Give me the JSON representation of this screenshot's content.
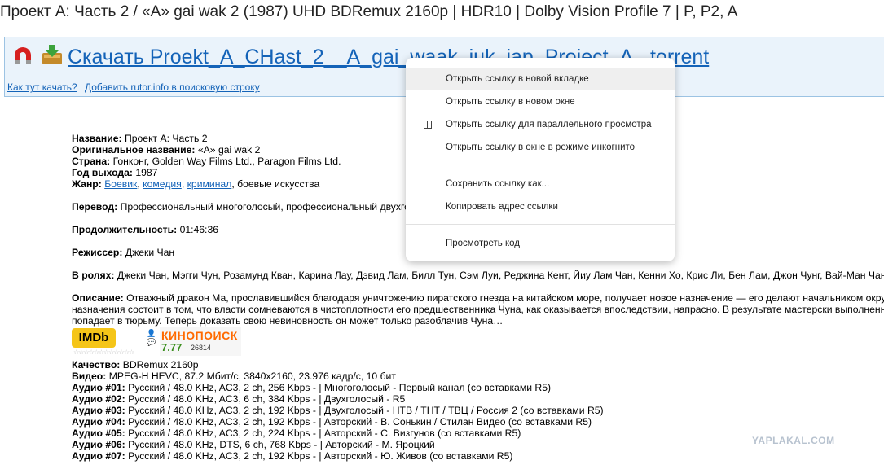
{
  "page": {
    "title": "Проект А: Часть 2 / «A» gai wak 2 (1987) UHD BDRemux 2160p | HDR10 | Dolby Vision Profile 7 | P, P2, A"
  },
  "download": {
    "link": "Скачать Proekt_A_CHast_2__A_gai_waak_juk_jap_Project_A_.torrent",
    "help1": "Как тут качать?",
    "help2": "Добавить rutor.info в поисковую строку"
  },
  "info": {
    "name_label": "Название:",
    "name_value": "Проект А: Часть 2",
    "orig_label": "Оригинальное название:",
    "orig_value": "«A» gai wak 2",
    "country_label": "Страна:",
    "country_value": "Гонконг, Golden Way Films Ltd., Paragon Films Ltd.",
    "year_label": "Год выхода:",
    "year_value": "1987",
    "genre_label": "Жанр:",
    "genre_1": "Боевик",
    "genre_2": "комедия",
    "genre_3": "криминал",
    "genre_rest": ", боевые искусства",
    "translation_label": "Перевод:",
    "translation_value": "Профессиональный многоголосый, профессиональный двухгол",
    "duration_label": "Продолжительность:",
    "duration_value": "01:46:36",
    "director_label": "Режиссер:",
    "director_value": "Джеки Чан",
    "cast_label": "В ролях:",
    "cast_value": "Джеки Чан, Мэгги Чун, Розамунд Кван, Карина Лау, Дэвид Лам, Билл Тун, Сэм Луи, Реджина Кент, Йиу Лам Чан, Кенни Хо, Крис Ли, Бен Лам, Джон Чунг, Вай-Ман Чан",
    "desc_label": "Описание:",
    "desc_1": "Отважный дракон Ма, прославившийся благодаря уничтожению пиратского гнезда на китайском море, получает новое назначение — его делают начальником округ",
    "desc_2": "назначения состоит в том, что власти сомневаются в чистоплотности его предшественника Чуна, как оказывается впоследствии, напрасно. В результате мастерски выполненной",
    "desc_3": "попадает в тюрьму. Теперь доказать свою невиновность он может только разоблачив Чуна…"
  },
  "ratings": {
    "imdb_label": "IMDb",
    "kp_label": "КИНОПОИСК",
    "kp_rating": "7.77",
    "kp_votes": "26814"
  },
  "tech": {
    "quality_label": "Качество:",
    "quality_value": "BDRemux 2160p",
    "video_label": "Видео:",
    "video_value": "MPEG-H HEVC, 87.2 Мбит/с, 3840x2160, 23.976 кадр/с, 10 бит",
    "audio": [
      {
        "label": "Аудио #01:",
        "value": "Русский / 48.0 KHz, AC3, 2 ch, 256 Kbps - | Многоголосый - Первый канал (со вставками R5)"
      },
      {
        "label": "Аудио #02:",
        "value": "Русский / 48.0 KHz, AC3, 6 ch, 384 Kbps - | Двухголосый - R5"
      },
      {
        "label": "Аудио #03:",
        "value": "Русский / 48.0 KHz, AC3, 2 ch, 192 Kbps - | Двухголосый - НТВ / ТНТ / ТВЦ / Россия 2 (со вставками R5)"
      },
      {
        "label": "Аудио #04:",
        "value": "Русский / 48.0 KHz, AC3, 2 ch, 192 Kbps - | Авторский - В. Сонькин / Стилан Видео (со вставками R5)"
      },
      {
        "label": "Аудио #05:",
        "value": "Русский / 48.0 KHz, AC3, 2 ch, 224 Kbps - | Авторский - С. Визгунов (со вставками R5)"
      },
      {
        "label": "Аудио #06:",
        "value": "Русский / 48.0 KHz, DTS, 6 ch, 768 Kbps - | Авторский - М. Яроцкий"
      },
      {
        "label": "Аудио #07:",
        "value": "Русский / 48.0 KHz, AC3, 2 ch, 192 Kbps - | Авторский - Ю. Живов (со вставками R5)"
      }
    ]
  },
  "context_menu": {
    "items": [
      "Открыть ссылку в новой вкладке",
      "Открыть ссылку в новом окне",
      "Открыть ссылку для параллельного просмотра",
      "Открыть ссылку в окне в режиме инкогнито",
      "Сохранить ссылку как...",
      "Копировать адрес ссылки",
      "Просмотреть код"
    ]
  },
  "watermark": "YAPLAKAL.COM"
}
